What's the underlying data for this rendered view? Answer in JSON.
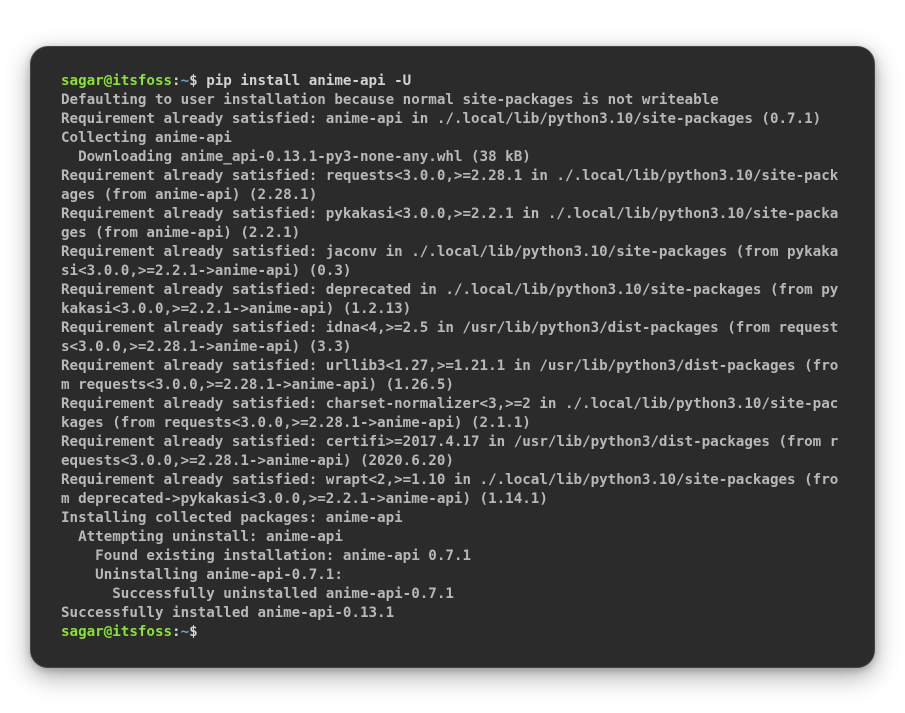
{
  "prompt1": {
    "user": "sagar@itsfoss",
    "colon": ":",
    "path": "~",
    "dollar": "$",
    "command": " pip install anime-api -U"
  },
  "output": {
    "l1": "Defaulting to user installation because normal site-packages is not writeable",
    "l2": "Requirement already satisfied: anime-api in ./.local/lib/python3.10/site-packages (0.7.1)",
    "l3": "Collecting anime-api",
    "l4": "  Downloading anime_api-0.13.1-py3-none-any.whl (38 kB)",
    "l5": "Requirement already satisfied: requests<3.0.0,>=2.28.1 in ./.local/lib/python3.10/site-packages (from anime-api) (2.28.1)",
    "l6": "Requirement already satisfied: pykakasi<3.0.0,>=2.2.1 in ./.local/lib/python3.10/site-packages (from anime-api) (2.2.1)",
    "l7": "Requirement already satisfied: jaconv in ./.local/lib/python3.10/site-packages (from pykakasi<3.0.0,>=2.2.1->anime-api) (0.3)",
    "l8": "Requirement already satisfied: deprecated in ./.local/lib/python3.10/site-packages (from pykakasi<3.0.0,>=2.2.1->anime-api) (1.2.13)",
    "l9": "Requirement already satisfied: idna<4,>=2.5 in /usr/lib/python3/dist-packages (from requests<3.0.0,>=2.28.1->anime-api) (3.3)",
    "l10": "Requirement already satisfied: urllib3<1.27,>=1.21.1 in /usr/lib/python3/dist-packages (from requests<3.0.0,>=2.28.1->anime-api) (1.26.5)",
    "l11": "Requirement already satisfied: charset-normalizer<3,>=2 in ./.local/lib/python3.10/site-packages (from requests<3.0.0,>=2.28.1->anime-api) (2.1.1)",
    "l12": "Requirement already satisfied: certifi>=2017.4.17 in /usr/lib/python3/dist-packages (from requests<3.0.0,>=2.28.1->anime-api) (2020.6.20)",
    "l13": "Requirement already satisfied: wrapt<2,>=1.10 in ./.local/lib/python3.10/site-packages (from deprecated->pykakasi<3.0.0,>=2.2.1->anime-api) (1.14.1)",
    "l14": "Installing collected packages: anime-api",
    "l15": "  Attempting uninstall: anime-api",
    "l16": "    Found existing installation: anime-api 0.7.1",
    "l17": "    Uninstalling anime-api-0.7.1:",
    "l18": "      Successfully uninstalled anime-api-0.7.1",
    "l19": "Successfully installed anime-api-0.13.1"
  },
  "prompt2": {
    "user": "sagar@itsfoss",
    "colon": ":",
    "path": "~",
    "dollar": "$",
    "command": " "
  }
}
